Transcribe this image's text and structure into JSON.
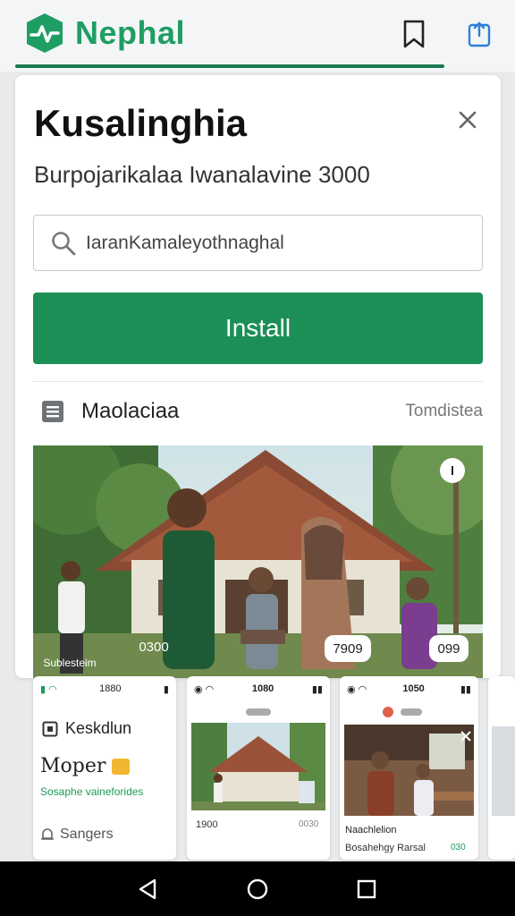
{
  "app": {
    "brand_name": "Nephal",
    "icons": {
      "logo": "nephal-logo",
      "bookmark": "bookmark-icon",
      "share": "share-icon"
    }
  },
  "card": {
    "title": "Kusalinghia",
    "subtitle": "Burpojarikalaa Iwanalavine 3000",
    "search_value": "IaranKamaleyothnaghal",
    "install_label": "Install",
    "section_label": "Maolaciaa",
    "section_link": "Tomdistea",
    "hero_badges": [
      "0300",
      "Sublesteim",
      "7909",
      "099"
    ]
  },
  "thumbnails": [
    {
      "status_time": "1880",
      "title": "Keskdlun",
      "promo": "Moper",
      "green_text": "Sosaphe vaineforides",
      "footer": "Sangers"
    },
    {
      "status_time": "1080",
      "caption_left": "1900",
      "caption_right": "0030"
    },
    {
      "status_time": "1050",
      "caption_title": "Naachlelion",
      "caption_sub": "Bosahehgy Rarsal",
      "caption_badge": "030"
    }
  ],
  "colors": {
    "brand_green": "#1f9e63",
    "install_green": "#1b8f56",
    "underline": "#1c7a52"
  },
  "navigation": {
    "back": "back-icon",
    "home": "home-icon",
    "recents": "recents-icon"
  }
}
